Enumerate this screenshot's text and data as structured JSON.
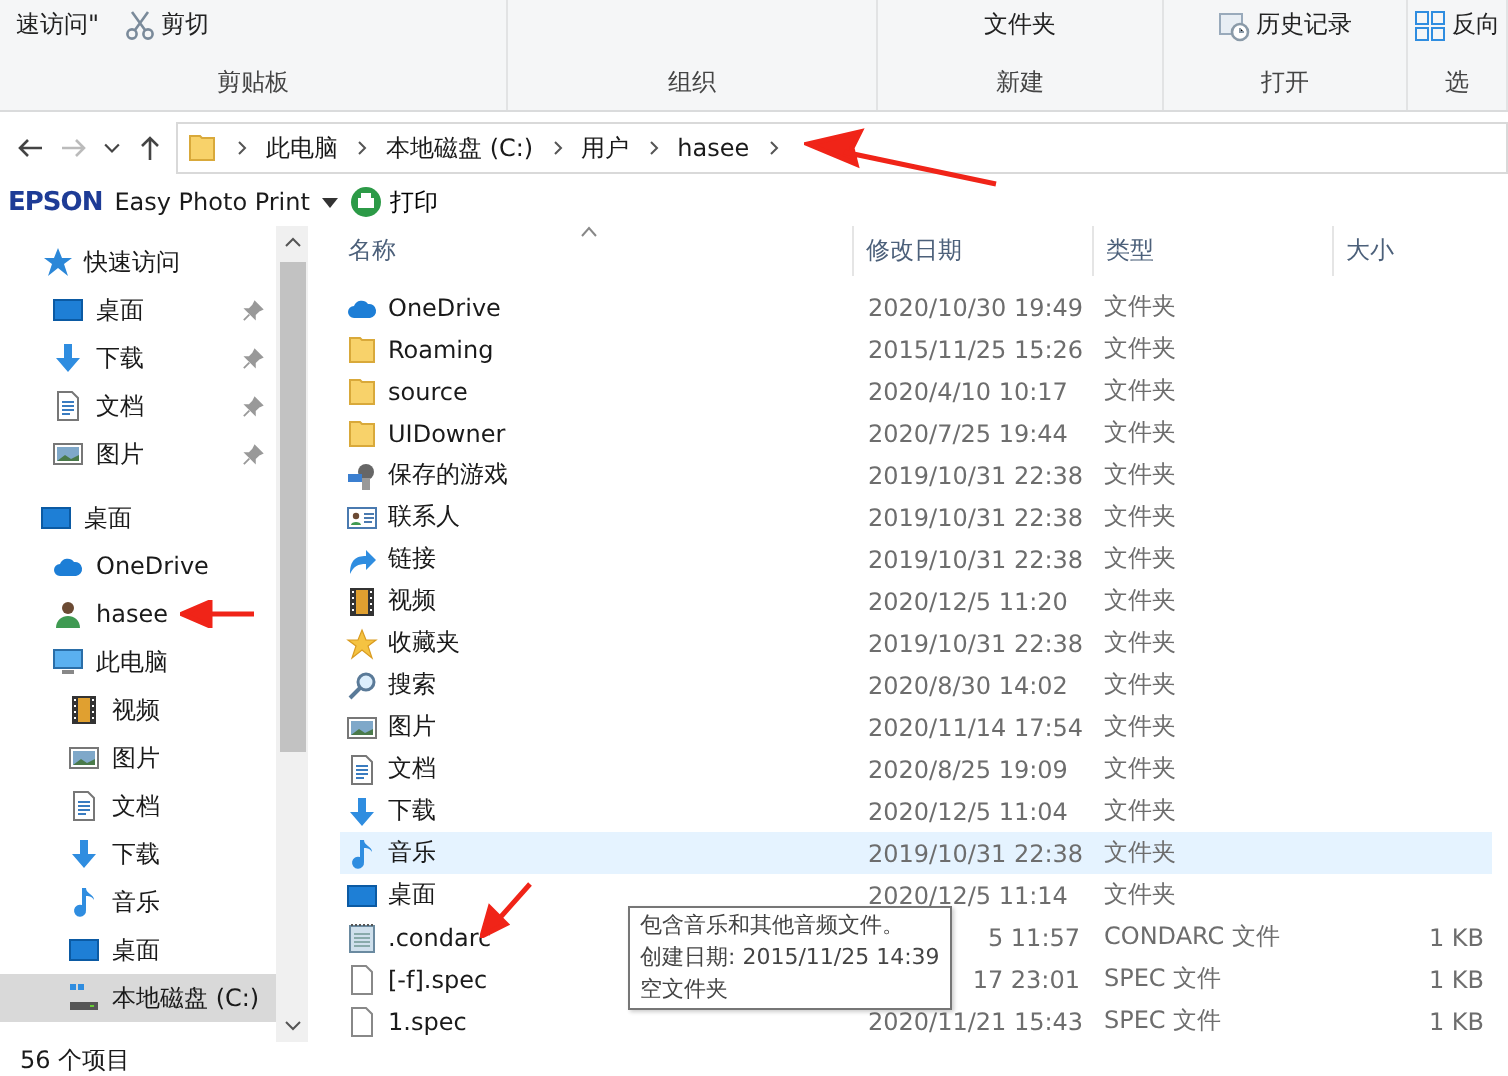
{
  "ribbon": {
    "groups": [
      {
        "label": "剪贴板",
        "items": [
          {
            "label": "速访问\"",
            "kind": "text"
          },
          {
            "label": "剪切",
            "kind": "scissors"
          }
        ]
      },
      {
        "label": "组织"
      },
      {
        "label": "新建",
        "items": [
          {
            "label": "文件夹",
            "kind": "text"
          }
        ]
      },
      {
        "label": "打开",
        "items": [
          {
            "label": "历史记录",
            "kind": "history"
          }
        ]
      },
      {
        "label": "选",
        "items": [
          {
            "label": "反向",
            "kind": "select"
          }
        ]
      }
    ]
  },
  "address": {
    "crumbs": [
      "此电脑",
      "本地磁盘 (C:)",
      "用户",
      "hasee"
    ]
  },
  "toolbar": {
    "brand": "EPSON",
    "app": "Easy Photo Print",
    "action": "打印"
  },
  "nav": [
    {
      "label": "快速访问",
      "kind": "star",
      "selected": false,
      "children": [
        {
          "label": "桌面",
          "kind": "desktop",
          "selected": false,
          "pinned": true
        },
        {
          "label": "下载",
          "kind": "downloads",
          "selected": false,
          "pinned": true
        },
        {
          "label": "文档",
          "kind": "documents",
          "selected": false,
          "pinned": true
        },
        {
          "label": "图片",
          "kind": "pictures",
          "selected": false,
          "pinned": true
        }
      ]
    },
    {
      "label": "桌面",
      "kind": "desktop",
      "selected": false,
      "children": [
        {
          "label": "OneDrive",
          "kind": "cloud",
          "selected": false
        },
        {
          "label": "hasee",
          "kind": "user",
          "selected": false
        },
        {
          "label": "此电脑",
          "kind": "computer",
          "selected": false,
          "children": [
            {
              "label": "视频",
              "kind": "video",
              "selected": false
            },
            {
              "label": "图片",
              "kind": "pictures",
              "selected": false
            },
            {
              "label": "文档",
              "kind": "documents",
              "selected": false
            },
            {
              "label": "下载",
              "kind": "downloads",
              "selected": false
            },
            {
              "label": "音乐",
              "kind": "music",
              "selected": false
            },
            {
              "label": "桌面",
              "kind": "desktop",
              "selected": false
            },
            {
              "label": "本地磁盘 (C:)",
              "kind": "drive",
              "selected": true
            }
          ]
        }
      ]
    }
  ],
  "table": {
    "columns": [
      "名称",
      "修改日期",
      "类型",
      "大小"
    ],
    "rows": [
      {
        "name": "OneDrive",
        "kind": "cloud",
        "date": "2020/10/30 19:49",
        "type": "文件夹",
        "size": "",
        "hovered": false
      },
      {
        "name": "Roaming",
        "kind": "folder",
        "date": "2015/11/25 15:26",
        "type": "文件夹",
        "size": "",
        "hovered": false
      },
      {
        "name": "source",
        "kind": "folder",
        "date": "2020/4/10 10:17",
        "type": "文件夹",
        "size": "",
        "hovered": false
      },
      {
        "name": "UIDowner",
        "kind": "folder",
        "date": "2020/7/25 19:44",
        "type": "文件夹",
        "size": "",
        "hovered": false
      },
      {
        "name": "保存的游戏",
        "kind": "games",
        "date": "2019/10/31 22:38",
        "type": "文件夹",
        "size": "",
        "hovered": false
      },
      {
        "name": "联系人",
        "kind": "contacts",
        "date": "2019/10/31 22:38",
        "type": "文件夹",
        "size": "",
        "hovered": false
      },
      {
        "name": "链接",
        "kind": "link",
        "date": "2019/10/31 22:38",
        "type": "文件夹",
        "size": "",
        "hovered": false
      },
      {
        "name": "视频",
        "kind": "video",
        "date": "2020/12/5 11:20",
        "type": "文件夹",
        "size": "",
        "hovered": false
      },
      {
        "name": "收藏夹",
        "kind": "favorites",
        "date": "2019/10/31 22:38",
        "type": "文件夹",
        "size": "",
        "hovered": false
      },
      {
        "name": "搜索",
        "kind": "search",
        "date": "2020/8/30 14:02",
        "type": "文件夹",
        "size": "",
        "hovered": false
      },
      {
        "name": "图片",
        "kind": "pictures",
        "date": "2020/11/14 17:54",
        "type": "文件夹",
        "size": "",
        "hovered": false
      },
      {
        "name": "文档",
        "kind": "documents",
        "date": "2020/8/25 19:09",
        "type": "文件夹",
        "size": "",
        "hovered": false
      },
      {
        "name": "下载",
        "kind": "downloads",
        "date": "2020/12/5 11:04",
        "type": "文件夹",
        "size": "",
        "hovered": false
      },
      {
        "name": "音乐",
        "kind": "music",
        "date": "2019/10/31 22:38",
        "type": "文件夹",
        "size": "",
        "hovered": true
      },
      {
        "name": "桌面",
        "kind": "desktop",
        "date": "2020/12/5 11:14",
        "type": "文件夹",
        "size": "",
        "hovered": false
      },
      {
        "name": ".condarc",
        "kind": "text",
        "date": "5 11:57",
        "date_covered": true,
        "type": "CONDARC 文件",
        "size": "1 KB",
        "hovered": false
      },
      {
        "name": "[-f].spec",
        "kind": "file",
        "date": "17 23:01",
        "date_covered": true,
        "type": "SPEC 文件",
        "size": "1 KB",
        "hovered": false
      },
      {
        "name": "1.spec",
        "kind": "file",
        "date": "2020/11/21 15:43",
        "type": "SPEC 文件",
        "size": "1 KB",
        "hovered": false
      }
    ]
  },
  "tooltip": {
    "lines": [
      "包含音乐和其他音频文件。",
      "创建日期: 2015/11/25 14:39",
      "空文件夹"
    ]
  },
  "status_bar": {
    "count": "56 个项目"
  }
}
